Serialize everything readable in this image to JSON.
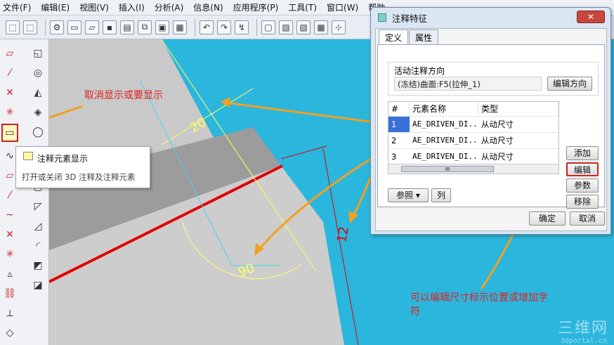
{
  "menu": [
    "文件(F)",
    "编辑(E)",
    "视图(V)",
    "插入(I)",
    "分析(A)",
    "信息(N)",
    "应用程序(P)",
    "工具(T)",
    "窗口(W)",
    "帮助"
  ],
  "tooltip": {
    "title": "注释元素显示",
    "description": "打开或关闭 3D 注释及注释元素"
  },
  "dialog": {
    "title": "注释特征",
    "close_label": "✕",
    "tabs": [
      "定义",
      "属性"
    ],
    "direction_group_label": "活动注释方向",
    "direction_value": "(冻结)曲面:F5(拉伸_1)",
    "edit_direction_button": "编辑方向",
    "table": {
      "headers": [
        "#",
        "元素名称",
        "类型"
      ],
      "rows": [
        {
          "num": "1",
          "name": "AE_DRIVEN_DI...",
          "type": "从动尺寸"
        },
        {
          "num": "2",
          "name": "AE_DRIVEN_DI...",
          "type": "从动尺寸"
        },
        {
          "num": "3",
          "name": "AE_DRIVEN_DI...",
          "type": "从动尺寸"
        }
      ],
      "scroll_label": "III"
    },
    "buttons": {
      "add": "添加",
      "edit": "编辑",
      "params": "参数",
      "remove": "移除",
      "refs": "参照 ▾",
      "columns": "列",
      "ok": "确定",
      "cancel": "取消"
    }
  },
  "annotations": {
    "top": "取消显示或要显示",
    "bottom": "可以编辑尺寸标示位置或增加字符"
  },
  "dimensions": {
    "d20": "20",
    "d12": "12",
    "d90": "90"
  },
  "watermark": {
    "big": "三维网",
    "small": "3dportal.cn"
  },
  "colors": {
    "annotation": "#e02020",
    "arrow": "#f2a020",
    "edge": "#e00000",
    "dim_yellow": "#ffff66"
  }
}
